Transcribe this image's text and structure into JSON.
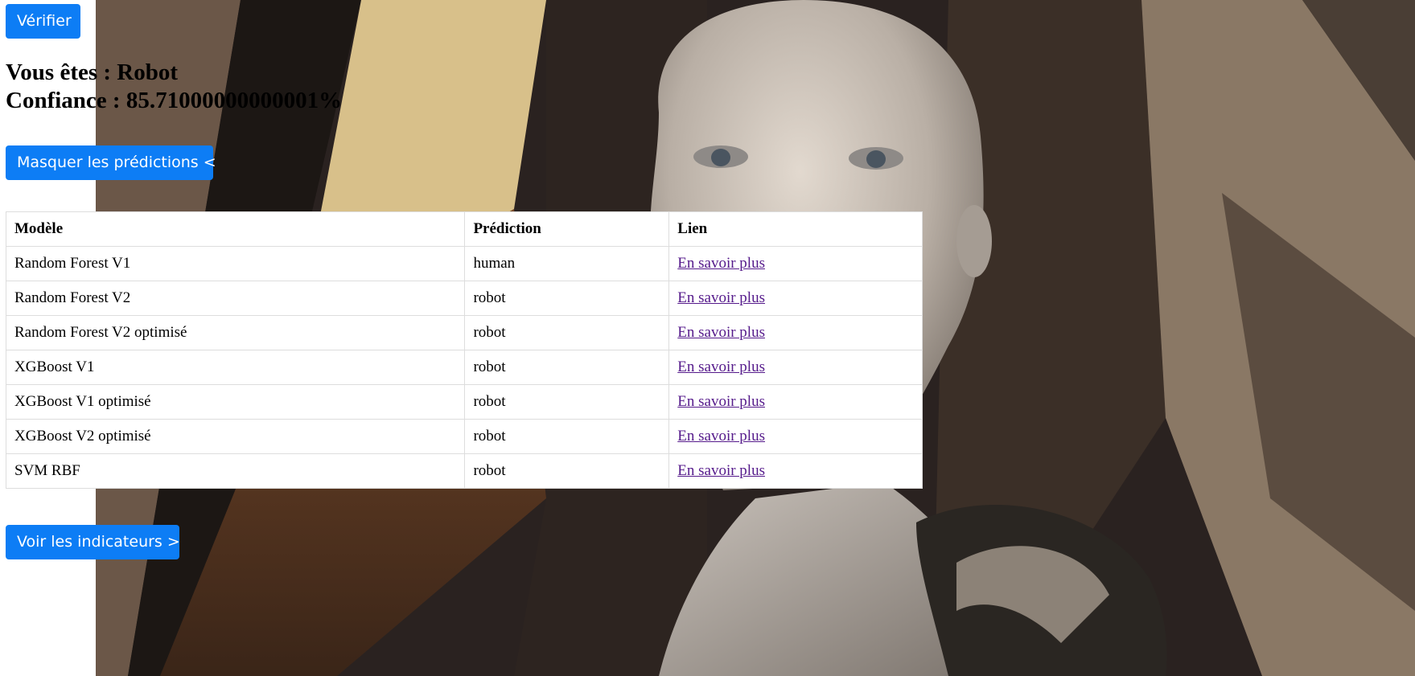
{
  "verify_button": "Vérifier",
  "result": {
    "label_line": "Vous êtes : Robot",
    "confidence_line": "Confiance : 85.71000000000001%"
  },
  "toggle_predictions_button": "Masquer les prédictions <",
  "table": {
    "headers": [
      "Modèle",
      "Prédiction",
      "Lien"
    ],
    "rows": [
      {
        "model": "Random Forest V1",
        "prediction": "human",
        "link": "En savoir plus"
      },
      {
        "model": "Random Forest V2",
        "prediction": "robot",
        "link": "En savoir plus"
      },
      {
        "model": "Random Forest V2 optimisé",
        "prediction": "robot",
        "link": "En savoir plus"
      },
      {
        "model": "XGBoost V1",
        "prediction": "robot",
        "link": "En savoir plus"
      },
      {
        "model": "XGBoost V1 optimisé",
        "prediction": "robot",
        "link": "En savoir plus"
      },
      {
        "model": "XGBoost V2 optimisé",
        "prediction": "robot",
        "link": "En savoir plus"
      },
      {
        "model": "SVM RBF",
        "prediction": "robot",
        "link": "En savoir plus"
      }
    ]
  },
  "indicators_button": "Voir les indicateurs >",
  "colors": {
    "button": "#0d7df5",
    "link_visited": "#551a8b"
  }
}
